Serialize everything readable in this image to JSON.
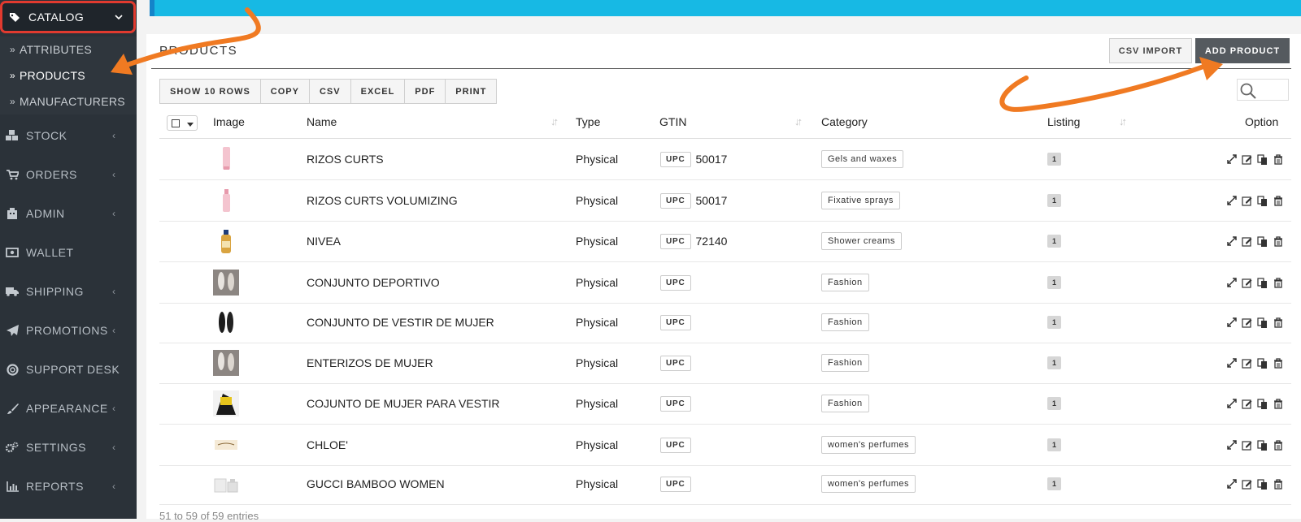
{
  "sidebar": {
    "catalog": "CATALOG",
    "sub_items": [
      {
        "label": "ATTRIBUTES",
        "active": false
      },
      {
        "label": "PRODUCTS",
        "active": true
      },
      {
        "label": "MANUFACTURERS",
        "active": false
      }
    ],
    "items": [
      {
        "label": "STOCK",
        "icon": "cubes-icon",
        "has_chevron": true
      },
      {
        "label": "ORDERS",
        "icon": "cart-icon",
        "has_chevron": true
      },
      {
        "label": "ADMIN",
        "icon": "building-icon",
        "has_chevron": true
      },
      {
        "label": "WALLET",
        "icon": "money-icon",
        "has_chevron": false
      },
      {
        "label": "SHIPPING",
        "icon": "truck-icon",
        "has_chevron": true
      },
      {
        "label": "PROMOTIONS",
        "icon": "paper-plane-icon",
        "has_chevron": true
      },
      {
        "label": "SUPPORT DESK",
        "icon": "life-ring-icon",
        "has_chevron": true
      },
      {
        "label": "APPEARANCE",
        "icon": "brush-icon",
        "has_chevron": true
      },
      {
        "label": "SETTINGS",
        "icon": "cogs-icon",
        "has_chevron": true
      },
      {
        "label": "REPORTS",
        "icon": "bar-chart-icon",
        "has_chevron": true
      }
    ]
  },
  "page": {
    "title": "PRODUCTS",
    "csv_import": "CSV IMPORT",
    "add_product": "ADD PRODUCT"
  },
  "toolbar": {
    "buttons": [
      "SHOW 10 ROWS",
      "COPY",
      "CSV",
      "EXCEL",
      "PDF",
      "PRINT"
    ]
  },
  "table": {
    "headers": {
      "image": "Image",
      "name": "Name",
      "type": "Type",
      "gtin": "GTIN",
      "category": "Category",
      "listing": "Listing",
      "option": "Option"
    },
    "rows": [
      {
        "name": "RIZOS CURTS",
        "type": "Physical",
        "gtin_type": "UPC",
        "gtin": "50017",
        "category": "Gels and waxes",
        "listing": "1",
        "thumb": "pink-tube"
      },
      {
        "name": "RIZOS CURTS VOLUMIZING",
        "type": "Physical",
        "gtin_type": "UPC",
        "gtin": "50017",
        "category": "Fixative sprays",
        "listing": "1",
        "thumb": "pink-spray"
      },
      {
        "name": "NIVEA",
        "type": "Physical",
        "gtin_type": "UPC",
        "gtin": "72140",
        "category": "Shower creams",
        "listing": "1",
        "thumb": "gold-bottle"
      },
      {
        "name": "CONJUNTO DEPORTIVO",
        "type": "Physical",
        "gtin_type": "UPC",
        "gtin": "",
        "category": "Fashion",
        "listing": "1",
        "thumb": "photo-grey"
      },
      {
        "name": "CONJUNTO DE VESTIR DE MUJER",
        "type": "Physical",
        "gtin_type": "UPC",
        "gtin": "",
        "category": "Fashion",
        "listing": "1",
        "thumb": "photo-black"
      },
      {
        "name": "ENTERIZOS DE MUJER",
        "type": "Physical",
        "gtin_type": "UPC",
        "gtin": "",
        "category": "Fashion",
        "listing": "1",
        "thumb": "photo-grey"
      },
      {
        "name": "COJUNTO DE MUJER PARA VESTIR",
        "type": "Physical",
        "gtin_type": "UPC",
        "gtin": "",
        "category": "Fashion",
        "listing": "1",
        "thumb": "photo-yellow"
      },
      {
        "name": "CHLOE'",
        "type": "Physical",
        "gtin_type": "UPC",
        "gtin": "",
        "category": "women's perfumes",
        "listing": "1",
        "thumb": "perfume-box"
      },
      {
        "name": "GUCCI BAMBOO WOMEN",
        "type": "Physical",
        "gtin_type": "UPC",
        "gtin": "",
        "category": "women's perfumes",
        "listing": "1",
        "thumb": "perfume-set"
      }
    ]
  },
  "footer": {
    "entries": "51 to 59 of 59 entries"
  },
  "colors": {
    "sidebar": "#2b3239",
    "banner": "#17b9e4",
    "annotation": "#f07a22",
    "highlight": "#e13a2f"
  }
}
